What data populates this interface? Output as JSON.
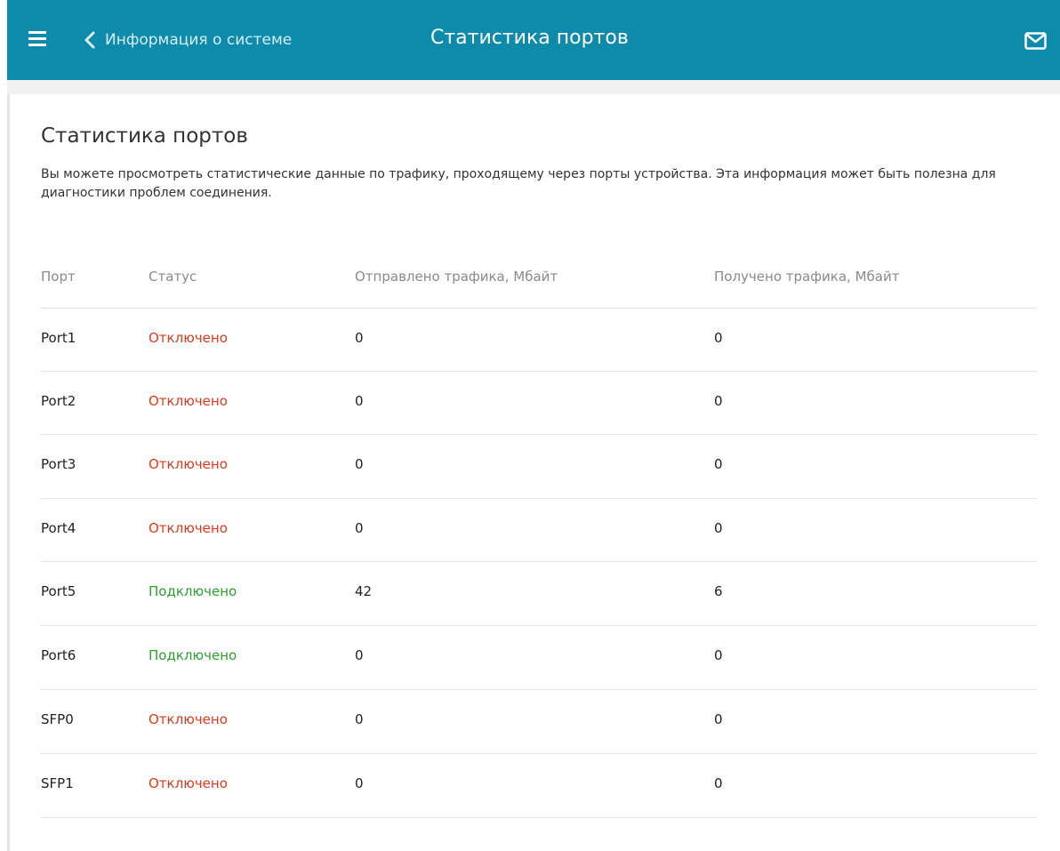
{
  "header": {
    "back_label": "Информация о системе",
    "title": "Статистика портов",
    "icons": {
      "menu": "menu-icon",
      "back": "chevron-left-icon",
      "notifications": "mail-icon"
    },
    "background_color": "#0e8aaa"
  },
  "page": {
    "title": "Статистика портов",
    "description": "Вы можете просмотреть статистические данные по трафику, проходящему через порты устройства. Эта информация может быть полезна для диагностики проблем соединения."
  },
  "table": {
    "columns": {
      "port": "Порт",
      "status": "Статус",
      "sent": "Отправлено трафика, Мбайт",
      "received": "Получено трафика, Мбайт"
    },
    "rows": [
      {
        "port": "Port1",
        "status": "Отключено",
        "sent": "0",
        "received": "0"
      },
      {
        "port": "Port2",
        "status": "Отключено",
        "sent": "0",
        "received": "0"
      },
      {
        "port": "Port3",
        "status": "Отключено",
        "sent": "0",
        "received": "0"
      },
      {
        "port": "Port4",
        "status": "Отключено",
        "sent": "0",
        "received": "0"
      },
      {
        "port": "Port5",
        "status": "Подключено",
        "sent": "42",
        "received": "6"
      },
      {
        "port": "Port6",
        "status": "Подключено",
        "sent": "0",
        "received": "0"
      },
      {
        "port": "SFP0",
        "status": "Отключено",
        "sent": "0",
        "received": "0"
      },
      {
        "port": "SFP1",
        "status": "Отключено",
        "sent": "0",
        "received": "0"
      }
    ]
  },
  "colors": {
    "disconnected": "#e2381d",
    "connected": "#2f9e2f"
  }
}
